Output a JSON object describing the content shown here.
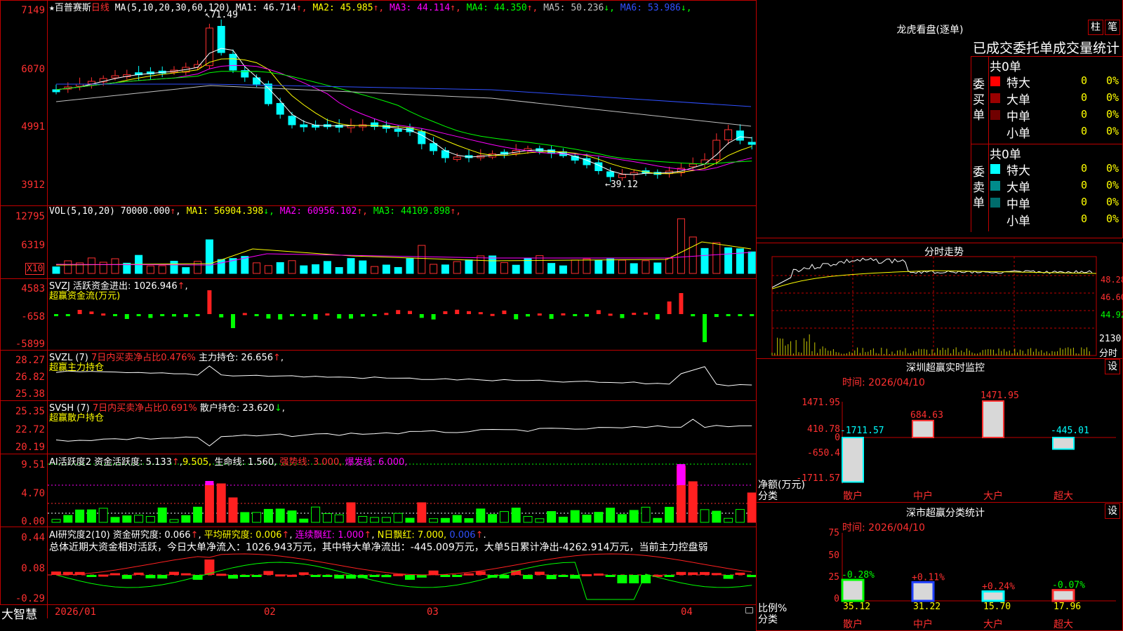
{
  "stock": {
    "star": "★",
    "name": "百普赛斯",
    "period": "日线"
  },
  "main": {
    "ma_title": "MA(5,10,20,30,60,120)",
    "ma": [
      {
        "label": "MA1:",
        "value": "46.714",
        "arrow": "↑",
        "color": "#ffffff"
      },
      {
        "label": "MA2:",
        "value": "45.985",
        "arrow": "↑",
        "color": "#ffff00"
      },
      {
        "label": "MA3:",
        "value": "44.114",
        "arrow": "↑",
        "color": "#ff00ff"
      },
      {
        "label": "MA4:",
        "value": "44.350",
        "arrow": "↑",
        "color": "#00ff00"
      },
      {
        "label": "MA5:",
        "value": "50.236",
        "arrow": "↓",
        "color": "#c0c0c0"
      },
      {
        "label": "MA6:",
        "value": "53.986",
        "arrow": "↓",
        "color": "#3050ff"
      }
    ],
    "y_labels": [
      "7149",
      "6070",
      "4991",
      "3912"
    ],
    "high_mark": "71.49",
    "low_mark": "39.12"
  },
  "vol": {
    "title": "VOL(5,10,20)",
    "value": "70000.000",
    "ma": [
      {
        "label": "MA1:",
        "value": "56904.398",
        "arrow": "↓",
        "color": "#ffff00"
      },
      {
        "label": "MA2:",
        "value": "60956.102",
        "arrow": "↑",
        "color": "#ff00ff"
      },
      {
        "label": "MA3:",
        "value": "44109.898",
        "arrow": "↑",
        "color": "#00ff00"
      }
    ],
    "y_labels": [
      "12795",
      "6319"
    ],
    "unit": "X10"
  },
  "svzj": {
    "title": "SVZJ",
    "line1_label": "活跃资金进出:",
    "line1_value": "1026.946",
    "line2": "超赢资金流(万元)",
    "y_labels": [
      "4583",
      "-658",
      "-5899"
    ]
  },
  "svzl": {
    "title": "SVZL (7)",
    "ratio_label": "7日内买卖净占比0.476%",
    "hold_label": "主力持仓:",
    "hold_value": "26.656",
    "line2": "超赢主力持仓",
    "y_labels": [
      "28.27",
      "26.82",
      "25.38"
    ]
  },
  "svsh": {
    "title": "SVSH (7)",
    "ratio_label": "7日内买卖净占比0.691%",
    "hold_label": "散户持仓:",
    "hold_value": "23.620",
    "line2": "超赢散户持仓",
    "y_labels": [
      "25.35",
      "22.72",
      "20.19"
    ]
  },
  "ai1": {
    "title": "AI活跃度2",
    "label1": "资金活跃度:",
    "value1": "5.133",
    "value2": "9.505,",
    "label3": "生命线:",
    "value3": "1.560,",
    "label4": "强势线:",
    "value4": "3.000,",
    "label5": "爆发线:",
    "value5": "6.000,",
    "y_labels": [
      "9.51",
      "4.70",
      "0.00"
    ]
  },
  "ai2": {
    "title": "AI研究度2(10)",
    "label1": "资金研究度:",
    "value1": "0.066",
    "label2": "平均研究度:",
    "value2": "0.006",
    "label3": "连续飘红:",
    "value3": "1.000",
    "label4": "N日飘红:",
    "value4": "7.000,",
    "value5": "0.006",
    "summary": "总体近期大资金相对活跃，今日大单净流入：1026.943万元，其中特大单净流出：-445.009万元，大单5日累计净出-4262.914万元，当前主力控盘弱",
    "y_labels": [
      "0.44",
      "0.08",
      "-0.29"
    ]
  },
  "xaxis": {
    "brand": "大智慧",
    "dates": [
      "2026/01",
      "02",
      "03",
      "04"
    ]
  },
  "dragon": {
    "title": "龙虎看盘(逐单)",
    "btn1": "柱",
    "btn2": "笔",
    "subtitle": "已成交委托单成交量统计",
    "buy": {
      "side": "委买单",
      "total": "共0单",
      "rows": [
        {
          "label": "特大",
          "count": "0",
          "pct": "0%",
          "color": "#ff0000"
        },
        {
          "label": "大单",
          "count": "0",
          "pct": "0%",
          "color": "#9a0000"
        },
        {
          "label": "中单",
          "count": "0",
          "pct": "0%",
          "color": "#700000"
        },
        {
          "label": "小单",
          "count": "0",
          "pct": "0%",
          "color": "#000000"
        }
      ]
    },
    "sell": {
      "side": "委卖单",
      "total": "共0单",
      "rows": [
        {
          "label": "特大",
          "count": "0",
          "pct": "0%",
          "color": "#00ffff"
        },
        {
          "label": "大单",
          "count": "0",
          "pct": "0%",
          "color": "#008b8b"
        },
        {
          "label": "中单",
          "count": "0",
          "pct": "0%",
          "color": "#006b6b"
        },
        {
          "label": "小单",
          "count": "0",
          "pct": "0%",
          "color": "#000000"
        }
      ]
    }
  },
  "intraday": {
    "title": "分时走势",
    "prices": [
      "48.28",
      "46.60",
      "44.92"
    ],
    "vol": "2130",
    "vol_unit": "分时"
  },
  "monitor": {
    "title": "深圳超赢实时监控",
    "btn": "设",
    "time": "时间: 2026/04/10",
    "y_labels": [
      "1471.95",
      "410.78",
      "0",
      "-650.4",
      "-1711.57"
    ],
    "bars": [
      {
        "cat": "散户",
        "value": -1711.57,
        "label": "-1711.57"
      },
      {
        "cat": "中户",
        "value": 684.63,
        "label": "684.63"
      },
      {
        "cat": "大户",
        "value": 1471.95,
        "label": "1471.95"
      },
      {
        "cat": "超大",
        "value": -445.01,
        "label": "-445.01"
      }
    ],
    "unit": "净额(万元)",
    "cat_title": "分类"
  },
  "classify": {
    "title": "深市超赢分类统计",
    "btn": "设",
    "time": "时间: 2026/04/10",
    "y_labels": [
      "75",
      "50",
      "25",
      "0"
    ],
    "bars": [
      {
        "cat": "散户",
        "value": 35.12,
        "label": "35.12",
        "change": "-0.28%"
      },
      {
        "cat": "中户",
        "value": 31.22,
        "label": "31.22",
        "change": "+0.11%"
      },
      {
        "cat": "大户",
        "value": 15.7,
        "label": "15.70",
        "change": "+0.24%"
      },
      {
        "cat": "超大",
        "value": 17.96,
        "label": "17.96",
        "change": "-0.07%"
      }
    ],
    "unit": "比例%",
    "cat_title": "分类"
  }
}
